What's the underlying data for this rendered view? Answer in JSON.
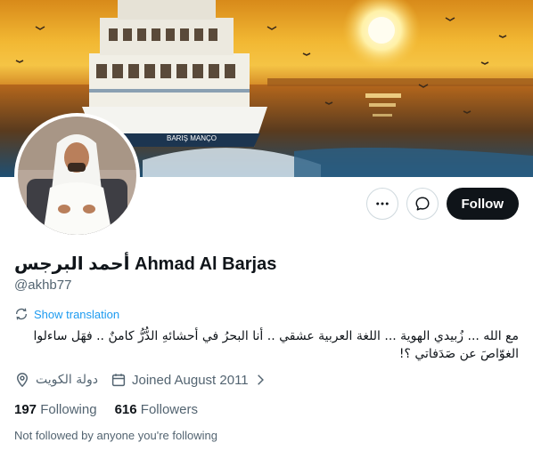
{
  "profile": {
    "display_name": "أحمد البرجس Ahmad Al Barjas",
    "handle": "@akhb77",
    "translate_label": "Show translation",
    "bio": "مع الله ... زُبيدي الهوية ... اللغة العربية عشقي .. أنا البحرُ في أحشائهِ الدُّرُّ كامنٌ .. فهَل ساءلوا الغوّاصَ عن صَدَفاتي ؟!",
    "location": "دولة الكويت",
    "joined": "Joined August 2011",
    "following_count": "197",
    "following_label": "Following",
    "followers_count": "616",
    "followers_label": "Followers",
    "not_followed_note": "Not followed by anyone you're following"
  },
  "banner": {
    "boat_name": "BARIŞ MANÇO"
  },
  "actions": {
    "more_icon": "more-icon",
    "message_icon": "message-icon",
    "follow_label": "Follow"
  },
  "colors": {
    "accent": "#1d9bf0",
    "follow_bg": "#0f1419",
    "secondary_text": "#536471"
  }
}
